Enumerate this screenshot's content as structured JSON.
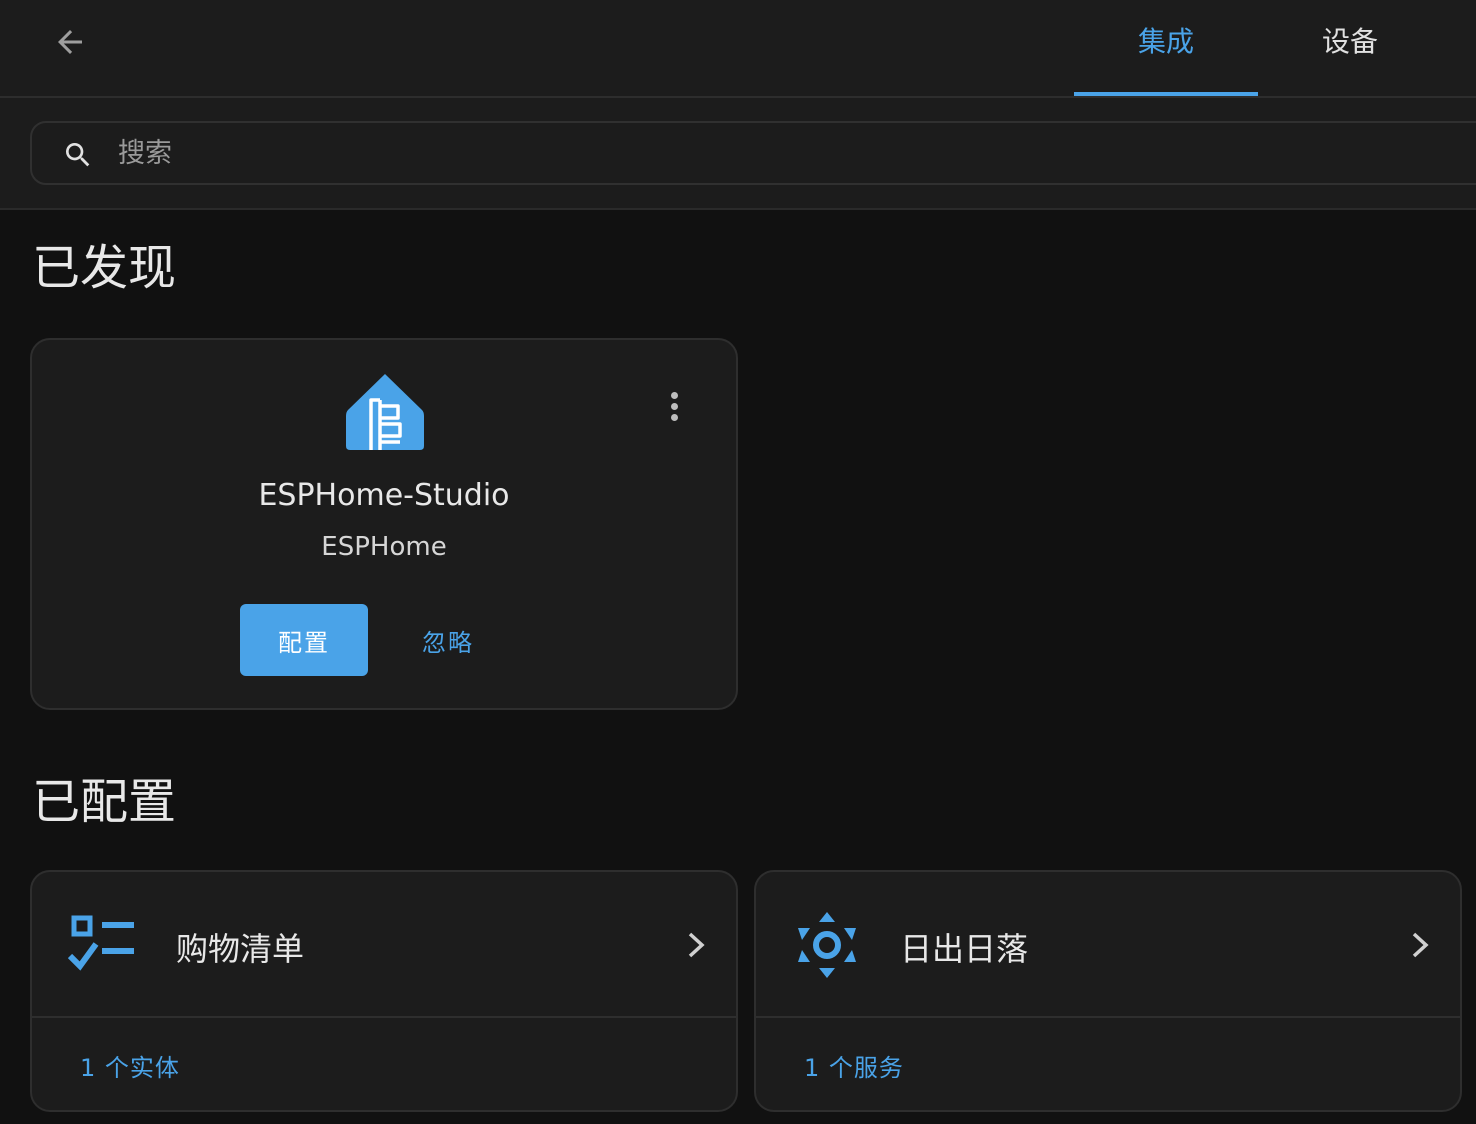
{
  "topbar": {
    "back_icon": "arrow-left-icon",
    "tabs": [
      {
        "label": "集成",
        "active": true
      },
      {
        "label": "设备",
        "active": false
      }
    ]
  },
  "search": {
    "placeholder": "搜索",
    "value": "",
    "icon": "search-icon"
  },
  "discovered": {
    "title": "已发现",
    "cards": [
      {
        "name": "ESPHome-Studio",
        "domain": "ESPHome",
        "logo": "esphome-logo",
        "configure_label": "配置",
        "ignore_label": "忽略"
      }
    ]
  },
  "configured": {
    "title": "已配置",
    "cards": [
      {
        "title": "购物清单",
        "icon": "checklist-icon",
        "footer": "1 个实体"
      },
      {
        "title": "日出日落",
        "icon": "sun-icon",
        "footer": "1 个服务"
      }
    ]
  },
  "colors": {
    "accent": "#4aa3e8",
    "background": "#111111",
    "card": "#1c1c1c"
  }
}
